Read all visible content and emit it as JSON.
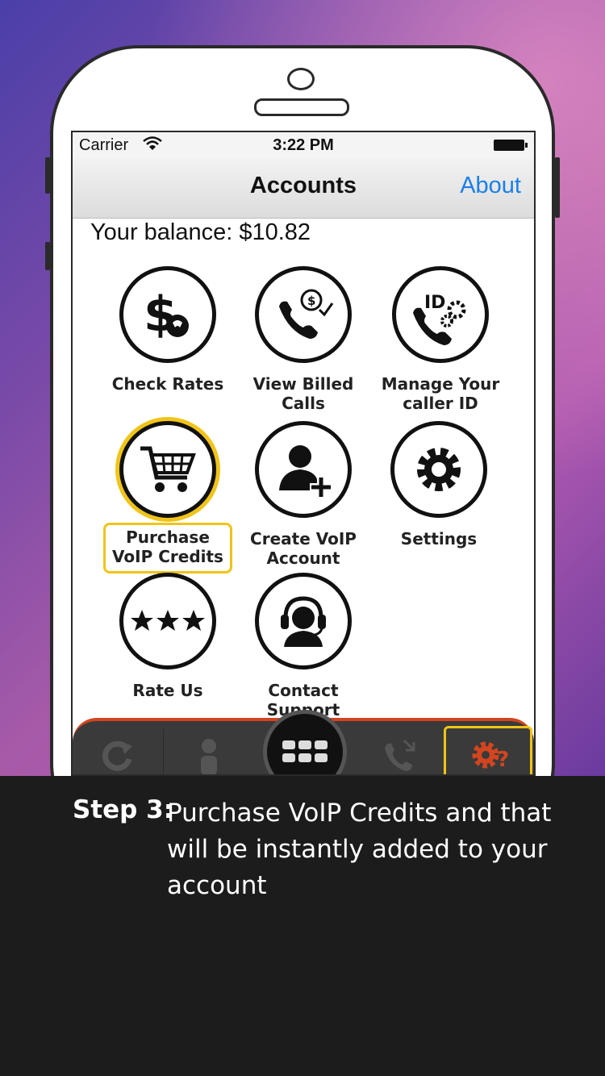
{
  "status_bar": {
    "carrier": "Carrier",
    "time": "3:22 PM"
  },
  "nav": {
    "title": "Accounts",
    "about": "About"
  },
  "balance": "Your balance: $10.82",
  "tiles": [
    {
      "label": "Check Rates",
      "icon": "dollar-phone-icon"
    },
    {
      "label": "View Billed Calls",
      "icon": "billed-call-icon"
    },
    {
      "label": "Manage Your caller ID",
      "icon": "caller-id-icon"
    },
    {
      "label": "Purchase VoIP Credits",
      "icon": "shopping-cart-icon"
    },
    {
      "label": "Create VoIP Account",
      "icon": "add-user-icon"
    },
    {
      "label": "Settings",
      "icon": "gear-icon"
    },
    {
      "label": "Rate Us",
      "icon": "stars-icon"
    },
    {
      "label": "Contact Support",
      "icon": "headset-icon"
    }
  ],
  "tab_bar": {
    "tabs": [
      "refresh-icon",
      "person-icon",
      "keypad-icon",
      "call-transfer-icon",
      "settings-help-icon"
    ]
  },
  "caption": {
    "step": "Step 3:",
    "text": "Purchase VoIP Credits and that will be instantly added to your account"
  },
  "colors": {
    "highlight": "#f0c419",
    "accent": "#d2451f",
    "link": "#1a7fe8"
  }
}
